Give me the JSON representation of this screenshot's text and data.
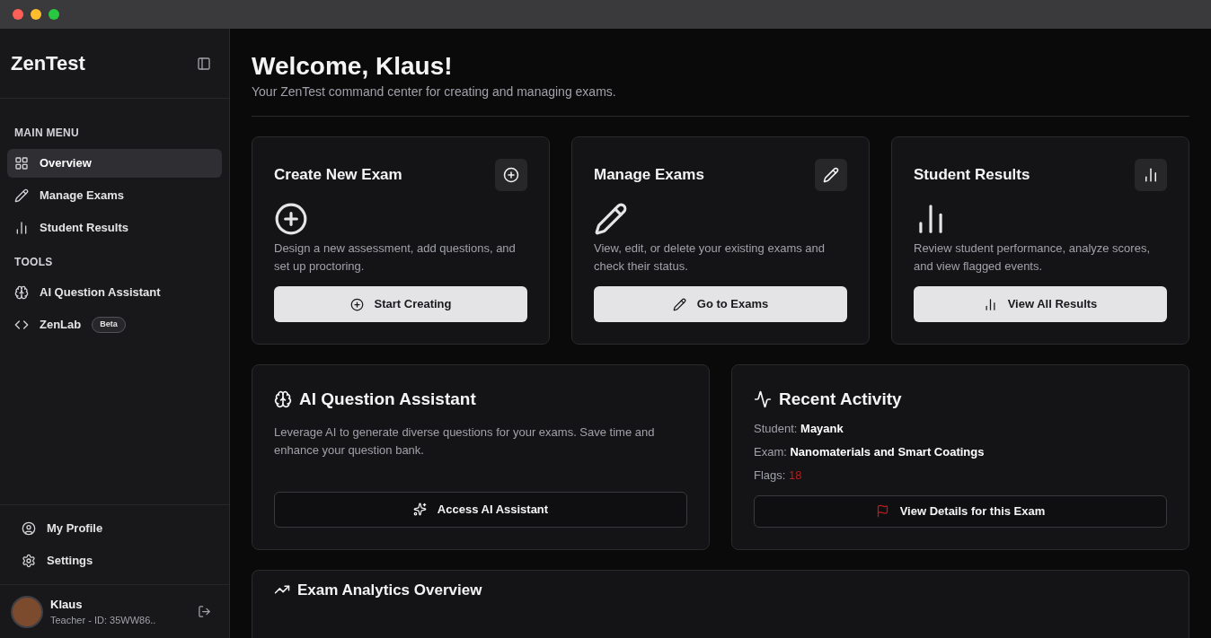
{
  "sidebar": {
    "brand": "ZenTest",
    "sections": [
      {
        "heading": "MAIN MENU",
        "items": [
          {
            "label": "Overview",
            "kind": "grid",
            "selected": true
          },
          {
            "label": "Manage Exams",
            "kind": "pen",
            "selected": false
          },
          {
            "label": "Student Results",
            "kind": "chart",
            "selected": false
          }
        ]
      },
      {
        "heading": "TOOLS",
        "items": [
          {
            "label": "AI Question Assistant",
            "kind": "brain",
            "selected": false
          },
          {
            "label": "ZenLab",
            "kind": "code",
            "selected": false,
            "badge": "Beta"
          }
        ]
      }
    ],
    "footer_items": [
      {
        "label": "My Profile",
        "kind": "user"
      },
      {
        "label": "Settings",
        "kind": "gear"
      }
    ],
    "user": {
      "name": "Klaus",
      "subtitle": "Teacher - ID: 35WW86.."
    }
  },
  "header": {
    "title": "Welcome, Klaus!",
    "subtitle": "Your ZenTest command center for creating and managing exams."
  },
  "cards": [
    {
      "title": "Create New Exam",
      "kind": "plus",
      "description": "Design a new assessment, add questions, and set up proctoring.",
      "button": "Start Creating"
    },
    {
      "title": "Manage Exams",
      "kind": "pen",
      "description": "View, edit, or delete your existing exams and check their status.",
      "button": "Go to Exams"
    },
    {
      "title": "Student Results",
      "kind": "chart",
      "description": "Review student performance, analyze scores, and view flagged events.",
      "button": "View All Results"
    }
  ],
  "ai_assistant": {
    "title": "AI Question Assistant",
    "description": "Leverage AI to generate diverse questions for your exams. Save time and enhance your question bank.",
    "button": "Access AI Assistant"
  },
  "recent_activity": {
    "title": "Recent Activity",
    "fields": [
      {
        "label": "Student:",
        "value": "Mayank",
        "kind": "text"
      },
      {
        "label": "Exam:",
        "value": "Nanomaterials and Smart Coatings",
        "kind": "text"
      },
      {
        "label": "Flags:",
        "value": "18",
        "kind": "alert"
      }
    ],
    "button": "View Details for this Exam"
  },
  "analytics": {
    "title": "Exam Analytics Overview"
  }
}
